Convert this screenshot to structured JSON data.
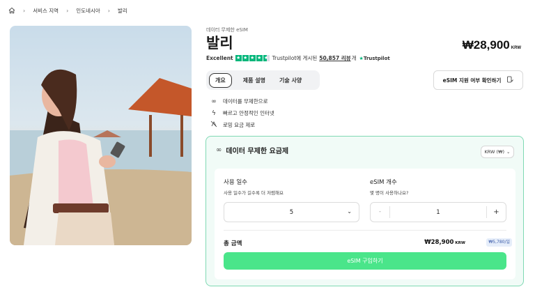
{
  "breadcrumb": {
    "items": [
      "서비스 지역",
      "인도네시아",
      "발리"
    ]
  },
  "product": {
    "subtitle": "데이터 무제한 eSIM",
    "title": "발리",
    "price": "₩28,900",
    "price_currency": "KRW"
  },
  "rating": {
    "label": "Excellent",
    "text_prefix": "Trustpilot에 게시된",
    "count": "50,857 리뷰",
    "text_suffix": "개",
    "logo": "Trustpilot",
    "stars": 4.5
  },
  "tabs": [
    {
      "label": "개요",
      "active": true
    },
    {
      "label": "제품 설명",
      "active": false
    },
    {
      "label": "기술 사양",
      "active": false
    }
  ],
  "check_button": {
    "label": "eSIM 지원 여부 확인하기",
    "icon": "device-check-icon"
  },
  "features": [
    {
      "icon": "infinity-icon",
      "label": "데이터를 무제한으로"
    },
    {
      "icon": "bolt-icon",
      "label": "빠르고 안정적인 인터넷"
    },
    {
      "icon": "no-roaming-icon",
      "label": "로밍 요금 제로"
    }
  ],
  "plan": {
    "title": "데이터 무제한 요금제",
    "currency_select": "KRW (₩)",
    "days_label": "사용 일수",
    "days_hint": "사용 일수가 길수록 더 저렴해요",
    "days_value": "5",
    "esim_label": "eSIM 개수",
    "esim_hint": "몇 명이 사용하나요?",
    "esim_value": "1",
    "minus": "-",
    "plus": "+",
    "total_label": "총 금액",
    "total_value": "₩28,900",
    "total_currency": "KRW",
    "per_day": "₩5,780/일",
    "buy_label": "eSIM 구입하기"
  },
  "colors": {
    "accent_green": "#4ae58a",
    "trustpilot_green": "#00b67a",
    "plan_border": "#7fd9b3",
    "plan_bg": "#f1fbf7"
  }
}
